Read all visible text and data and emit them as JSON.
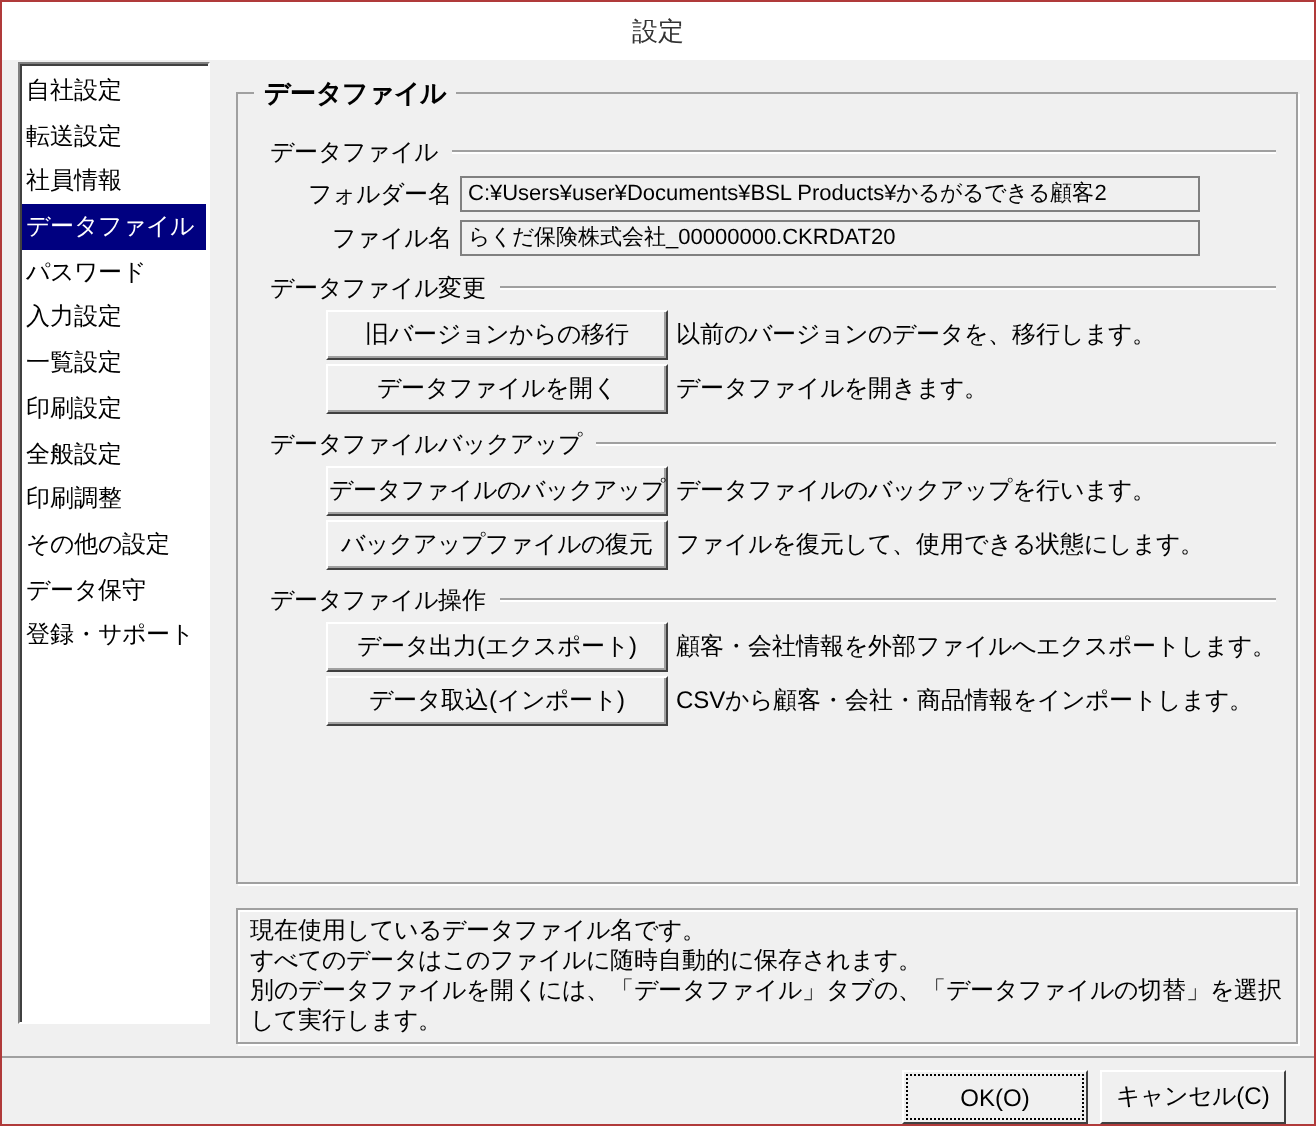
{
  "window": {
    "title": "設定"
  },
  "sidebar": {
    "items": [
      {
        "label": "自社設定",
        "selected": false
      },
      {
        "label": "転送設定",
        "selected": false
      },
      {
        "label": "社員情報",
        "selected": false
      },
      {
        "label": "データファイル",
        "selected": true
      },
      {
        "label": "パスワード",
        "selected": false
      },
      {
        "label": "入力設定",
        "selected": false
      },
      {
        "label": "一覧設定",
        "selected": false
      },
      {
        "label": "印刷設定",
        "selected": false
      },
      {
        "label": "全般設定",
        "selected": false
      },
      {
        "label": "印刷調整",
        "selected": false
      },
      {
        "label": "その他の設定",
        "selected": false
      },
      {
        "label": "データ保守",
        "selected": false
      },
      {
        "label": "登録・サポート",
        "selected": false
      }
    ]
  },
  "group": {
    "title": "データファイル",
    "sections": [
      {
        "kind": "fields",
        "heading": "データファイル",
        "fields": [
          {
            "label": "フォルダー名",
            "value": "C:¥Users¥user¥Documents¥BSL Products¥かるがるできる顧客2"
          },
          {
            "label": "ファイル名",
            "value": "らくだ保険株式会社_00000000.CKRDAT20"
          }
        ]
      },
      {
        "kind": "actions",
        "heading": "データファイル変更",
        "actions": [
          {
            "button": "旧バージョンからの移行",
            "description": "以前のバージョンのデータを、移行します。"
          },
          {
            "button": "データファイルを開く",
            "description": "データファイルを開きます。"
          }
        ]
      },
      {
        "kind": "actions",
        "heading": "データファイルバックアップ",
        "actions": [
          {
            "button": "データファイルのバックアップ",
            "description": "データファイルのバックアップを行います。"
          },
          {
            "button": "バックアップファイルの復元",
            "description": "ファイルを復元して、使用できる状態にします。"
          }
        ]
      },
      {
        "kind": "actions",
        "heading": "データファイル操作",
        "actions": [
          {
            "button": "データ出力(エクスポート)",
            "description": "顧客・会社情報を外部ファイルへエクスポートします。"
          },
          {
            "button": "データ取込(インポート)",
            "description": "CSVから顧客・会社・商品情報をインポートします。"
          }
        ]
      }
    ]
  },
  "help": {
    "lines": [
      "現在使用しているデータファイル名です。",
      "すべてのデータはこのファイルに随時自動的に保存されます。",
      "別のデータファイルを開くには、「データファイル」タブの、「データファイルの切替」を選択して実行します。"
    ]
  },
  "buttons": [
    {
      "label": "OK(O)",
      "focused": true
    },
    {
      "label": "キャンセル(C)",
      "focused": false
    }
  ]
}
